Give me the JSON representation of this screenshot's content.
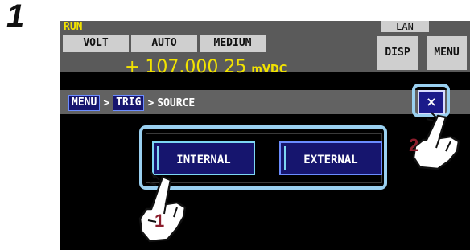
{
  "step": {
    "number": "1"
  },
  "status": {
    "run": "RUN",
    "lan": "LAN"
  },
  "modes": {
    "function": "VOLT",
    "range": "AUTO",
    "speed": "MEDIUM"
  },
  "reading": {
    "value": "+ 107.000 25",
    "unit": "mVDC"
  },
  "buttons": {
    "disp": "DISP",
    "menu": "MENU",
    "close": "×"
  },
  "breadcrumb": {
    "menu": "MENU",
    "sep1": ">",
    "trig": "TRIG",
    "sep2": ">",
    "current": "SOURCE"
  },
  "options": {
    "internal": "INTERNAL",
    "external": "EXTERNAL"
  },
  "callouts": {
    "one": "1",
    "two": "2"
  },
  "colors": {
    "screen_bg": "#000000",
    "bar_gray": "#5a5a5a",
    "accent_yellow": "#f2e300",
    "button_blue": "#16156e",
    "highlight_blue": "#9ad0f0",
    "callout_red": "#8b1d2c"
  }
}
